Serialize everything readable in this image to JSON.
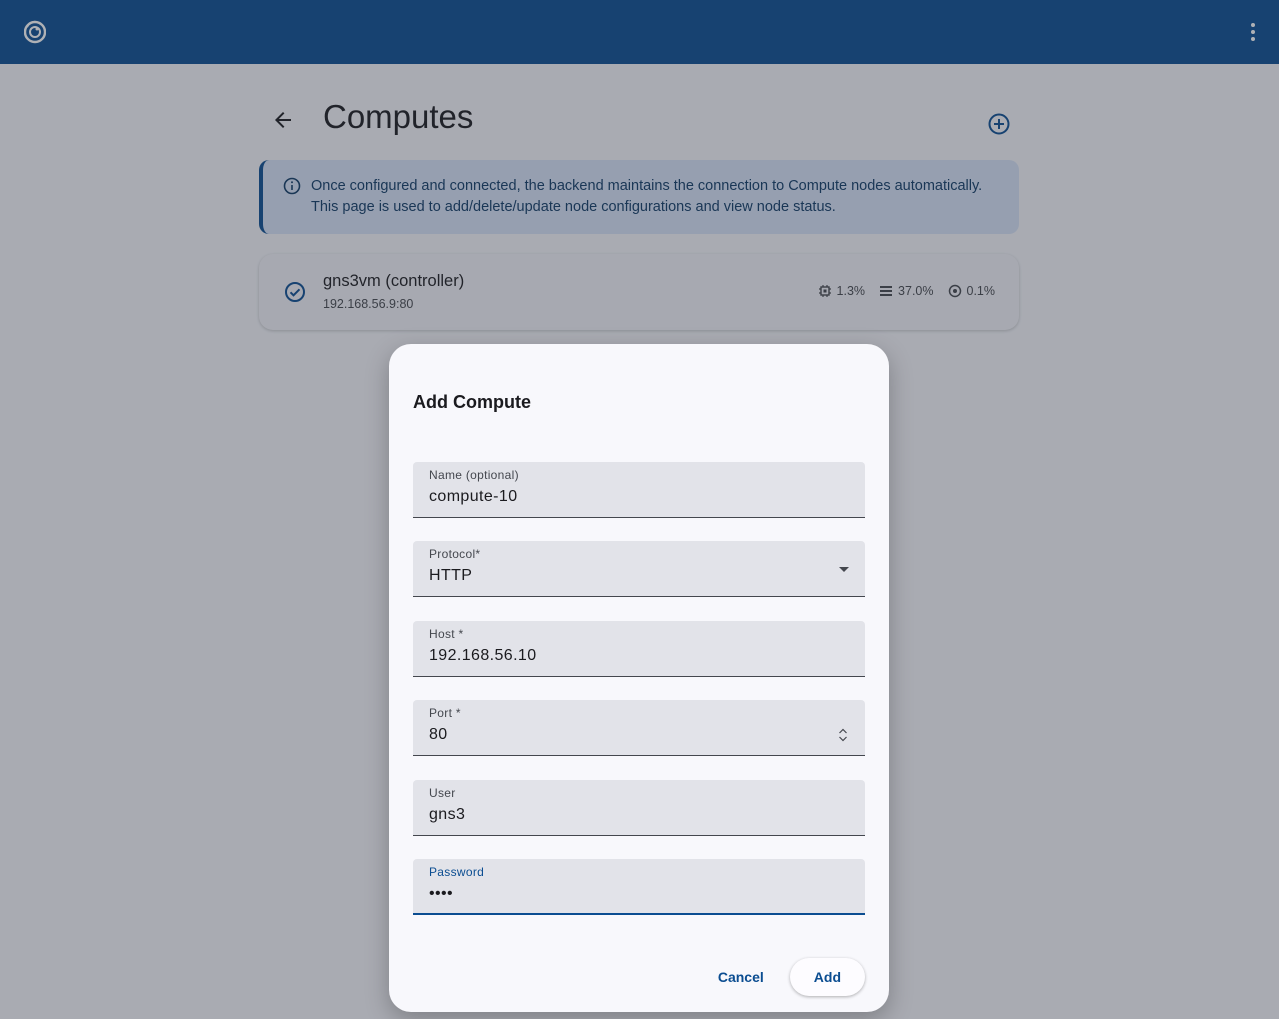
{
  "toolbar": {
    "logo_icon": "gns3-chameleon-logo",
    "menu_icon": "more-vert-icon",
    "color": "#0b4d91"
  },
  "page": {
    "title": "Computes",
    "info_text": "Once configured and connected, the backend maintains the connection to Compute nodes automatically. This page is used to add/delete/update node configurations and view node status."
  },
  "compute": {
    "name": "gns3vm (controller)",
    "address": "192.168.56.9:80",
    "stats": {
      "cpu": "1.3%",
      "memory": "37.0%",
      "disk": "0.1%"
    }
  },
  "dialog": {
    "title": "Add Compute",
    "fields": {
      "name": {
        "label": "Name (optional)",
        "value": "compute-10"
      },
      "protocol": {
        "label": "Protocol*",
        "value": "HTTP"
      },
      "host": {
        "label": "Host *",
        "value": "192.168.56.10"
      },
      "port": {
        "label": "Port *",
        "value": "80"
      },
      "user": {
        "label": "User",
        "value": "gns3"
      },
      "password": {
        "label": "Password",
        "value": "••••"
      }
    },
    "cancel_label": "Cancel",
    "add_label": "Add"
  }
}
